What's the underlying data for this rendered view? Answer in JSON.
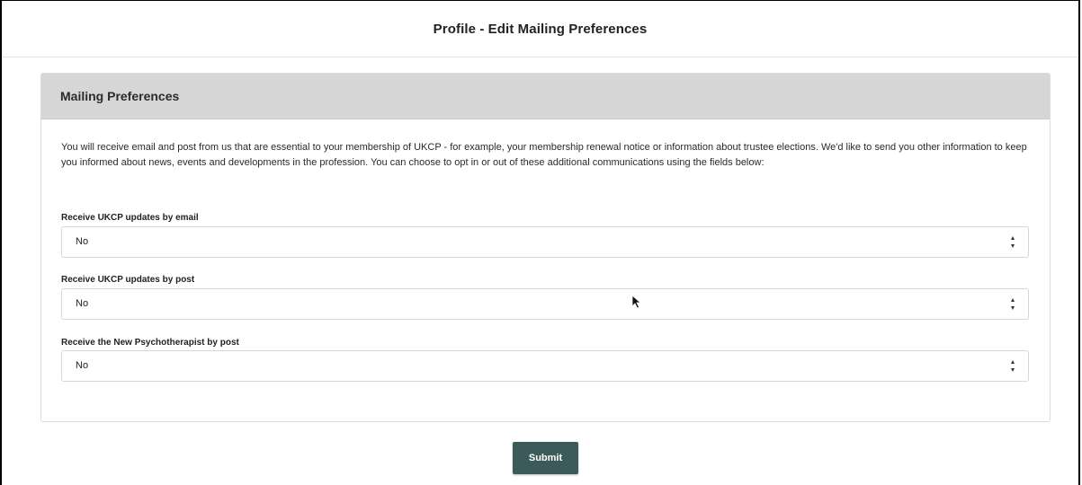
{
  "header": {
    "title": "Profile - Edit Mailing Preferences"
  },
  "panel": {
    "title": "Mailing Preferences",
    "intro": "You will receive email and post from us that are essential to your membership of UKCP - for example, your membership renewal notice or information about trustee elections. We'd like to send you other information to keep you informed about news, events and developments in the profession. You can choose to opt in or out of these additional communications using the fields below:"
  },
  "fields": [
    {
      "label": "Receive UKCP updates by email",
      "value": "No"
    },
    {
      "label": "Receive UKCP updates by post",
      "value": "No"
    },
    {
      "label": "Receive the New Psychotherapist by post",
      "value": "No"
    }
  ],
  "actions": {
    "submit_label": "Submit"
  },
  "colors": {
    "submit_bg": "#3b5a59",
    "panel_header_bg": "#d6d6d6"
  }
}
